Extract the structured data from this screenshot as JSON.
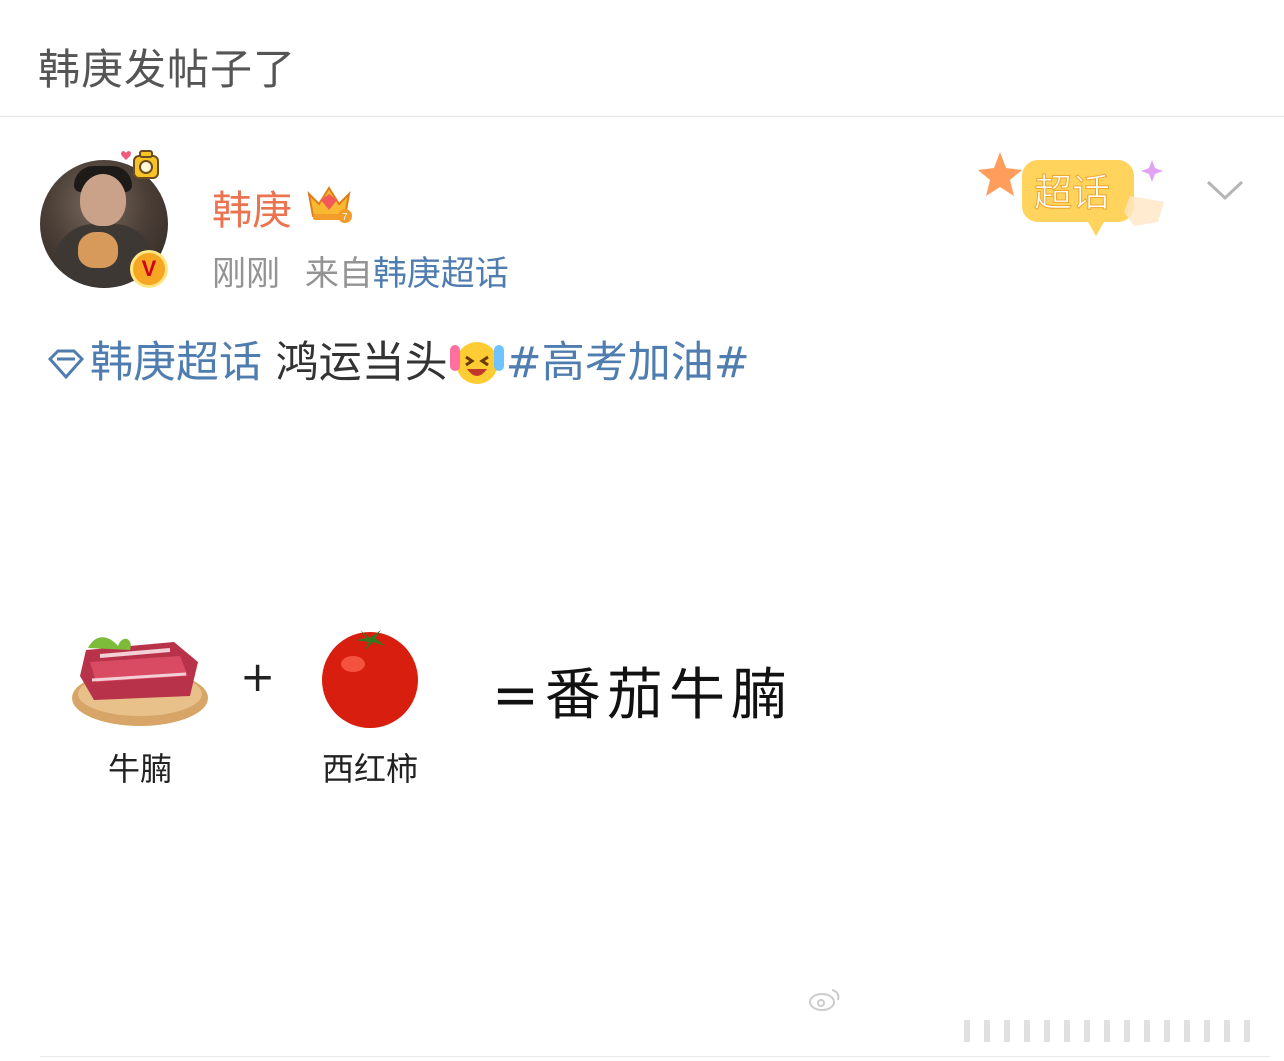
{
  "header": {
    "title": "韩庚发帖子了"
  },
  "post": {
    "author": {
      "name": "韩庚",
      "avatar_icon": "user-avatar",
      "verified_icon": "v-badge",
      "verified_letter": "V"
    },
    "meta": {
      "time": "刚刚",
      "from_prefix": "来自",
      "source": "韩庚超话"
    },
    "badge": {
      "label": "超话"
    },
    "text": {
      "topic_link": "韩庚超话",
      "body": " 鸿运当头",
      "emoji": "laughing-crying-emoji",
      "hashtag": "#高考加油#"
    },
    "image": {
      "items": [
        {
          "icon": "beef-brisket-image",
          "caption": "牛腩"
        },
        {
          "icon": "tomato-image",
          "caption": "西红柿"
        }
      ],
      "plus": "+",
      "equation": "=番茄牛腩"
    }
  },
  "colors": {
    "username": "#eb7350",
    "link": "#507daf",
    "meta": "#939393"
  }
}
